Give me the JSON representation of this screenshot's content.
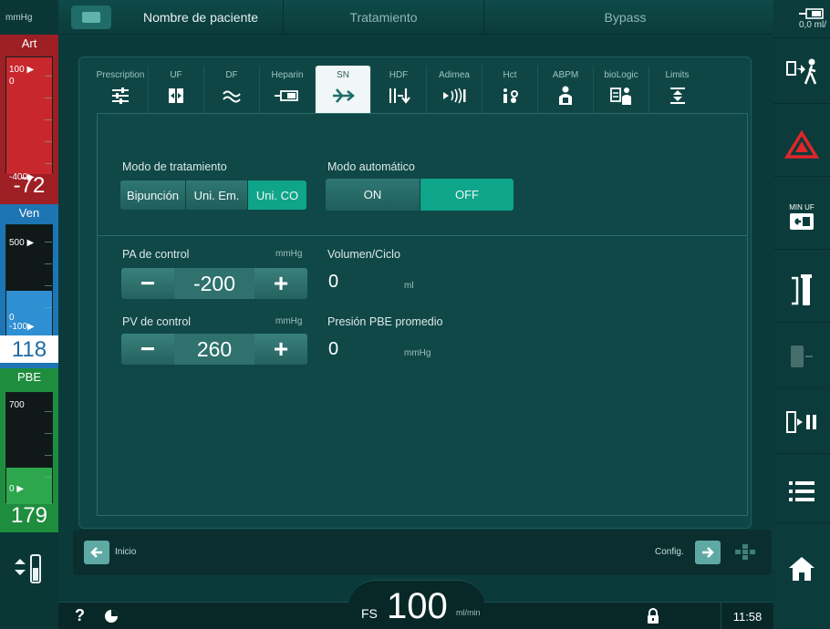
{
  "left": {
    "unit": "mmHg",
    "art": {
      "title": "Art",
      "top": "100 ▶",
      "zero": "0",
      "bottom": "-400▶",
      "value": "-72",
      "color": "#c2252a"
    },
    "ven": {
      "title": "Ven",
      "top": "500 ▶",
      "zero": "0",
      "bottom": "-100▶",
      "value": "118",
      "color": "#2b8ccf"
    },
    "pbe": {
      "title": "PBE",
      "top": "700",
      "bottom": "0  ▶",
      "value": "179",
      "color": "#2ea34c"
    }
  },
  "topbar": {
    "tabs": [
      "Nombre de paciente",
      "Tratamiento",
      "Bypass"
    ]
  },
  "right": {
    "top_label": "0,0  ml/",
    "min_uf": "MIN UF"
  },
  "subtabs": [
    {
      "label": "Prescription",
      "icon": "sliders-icon"
    },
    {
      "label": "UF",
      "icon": "uf-icon"
    },
    {
      "label": "DF",
      "icon": "approx-icon"
    },
    {
      "label": "Heparin",
      "icon": "syringe-icon"
    },
    {
      "label": "SN",
      "icon": "single-needle-icon"
    },
    {
      "label": "HDF",
      "icon": "hdf-icon"
    },
    {
      "label": "Adimea",
      "icon": "adimea-icon"
    },
    {
      "label": "Hct",
      "icon": "hct-icon"
    },
    {
      "label": "ABPM",
      "icon": "abpm-icon"
    },
    {
      "label": "bioLogic",
      "icon": "biologic-icon"
    },
    {
      "label": "Limits",
      "icon": "limits-icon"
    }
  ],
  "main": {
    "modo_tratamiento": {
      "label": "Modo de tratamiento",
      "options": [
        "Bipunción",
        "Uni. Em.",
        "Uni. CO"
      ],
      "selected": "Uni. CO"
    },
    "modo_automatico": {
      "label": "Modo automático",
      "options": [
        "ON",
        "OFF"
      ],
      "selected": "OFF"
    },
    "pa_control": {
      "label": "PA de control",
      "unit": "mmHg",
      "value": "-200"
    },
    "pv_control": {
      "label": "PV de control",
      "unit": "mmHg",
      "value": "260"
    },
    "volumen": {
      "label": "Volumen/Ciclo",
      "value": "0",
      "unit": "ml"
    },
    "presion_pbe": {
      "label": "Presión PBE promedio",
      "value": "0",
      "unit": "mmHg"
    }
  },
  "nav": {
    "back_label": "Inicio",
    "config_label": "Config."
  },
  "status": {
    "fs": "FS",
    "flow": "100",
    "flow_unit": "ml/min",
    "time": "11:58"
  }
}
